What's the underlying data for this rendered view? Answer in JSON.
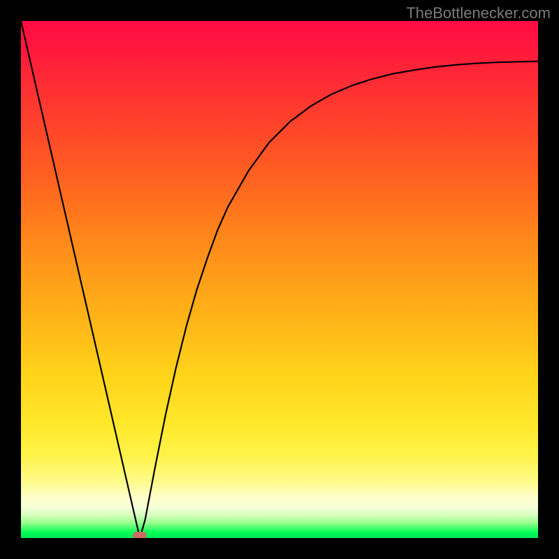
{
  "attribution": "TheBottlenecker.com",
  "colors": {
    "frame": "#000000",
    "curve": "#000000",
    "marker": "#c96e62",
    "attribution_text": "#7b7b7b"
  },
  "chart_data": {
    "type": "line",
    "title": "",
    "xlabel": "",
    "ylabel": "",
    "xlim": [
      0,
      100
    ],
    "ylim": [
      0,
      100
    ],
    "x": [
      0,
      2,
      4,
      6,
      8,
      10,
      12,
      14,
      16,
      18,
      20,
      22,
      23,
      24,
      26,
      28,
      30,
      32,
      34,
      36,
      38,
      40,
      44,
      48,
      52,
      56,
      60,
      64,
      68,
      72,
      76,
      80,
      84,
      88,
      92,
      96,
      100
    ],
    "values": [
      100,
      91.3,
      82.6,
      73.9,
      65.2,
      56.5,
      47.8,
      39.1,
      30.4,
      21.7,
      13.0,
      4.3,
      0,
      3.5,
      14,
      24,
      33,
      41,
      48,
      54,
      59.5,
      64,
      71,
      76.5,
      80.5,
      83.5,
      85.8,
      87.5,
      88.8,
      89.8,
      90.5,
      91.1,
      91.5,
      91.8,
      92.0,
      92.1,
      92.2
    ],
    "annotations": [
      {
        "name": "min-marker",
        "x": 23,
        "y": 0
      }
    ]
  }
}
